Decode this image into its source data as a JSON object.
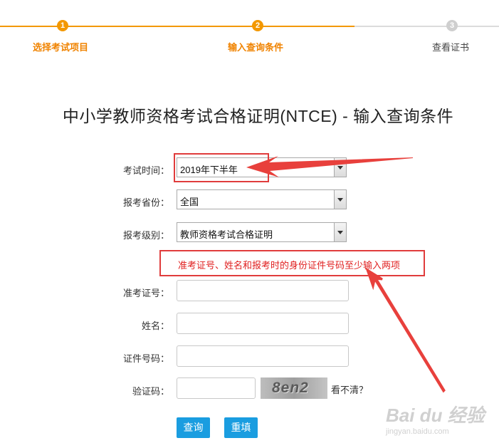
{
  "stepper": {
    "steps": [
      {
        "number": "1",
        "label": "选择考试项目"
      },
      {
        "number": "2",
        "label": "输入查询条件"
      },
      {
        "number": "3",
        "label": "查看证书"
      }
    ]
  },
  "page_title": "中小学教师资格考试合格证明(NTCE) - 输入查询条件",
  "form": {
    "exam_time": {
      "label": "考试时间：",
      "value": "2019年下半年"
    },
    "province": {
      "label": "报考省份：",
      "value": "全国"
    },
    "level": {
      "label": "报考级别：",
      "value": "教师资格考试合格证明"
    },
    "hint": "准考证号、姓名和报考时的身份证件号码至少输入两项",
    "admission_no": {
      "label": "准考证号：",
      "value": ""
    },
    "name": {
      "label": "姓名：",
      "value": ""
    },
    "id_no": {
      "label": "证件号码：",
      "value": ""
    },
    "captcha": {
      "label": "验证码：",
      "value": "",
      "image_text": "8en2",
      "refresh_label": "看不清？"
    }
  },
  "buttons": {
    "query": "查询",
    "reset": "重填"
  },
  "watermark": {
    "main": "Bai du 经验",
    "sub": "jingyan.baidu.com"
  },
  "colors": {
    "accent": "#f39800",
    "button": "#1a9de0",
    "annotation": "#e03c3c"
  }
}
